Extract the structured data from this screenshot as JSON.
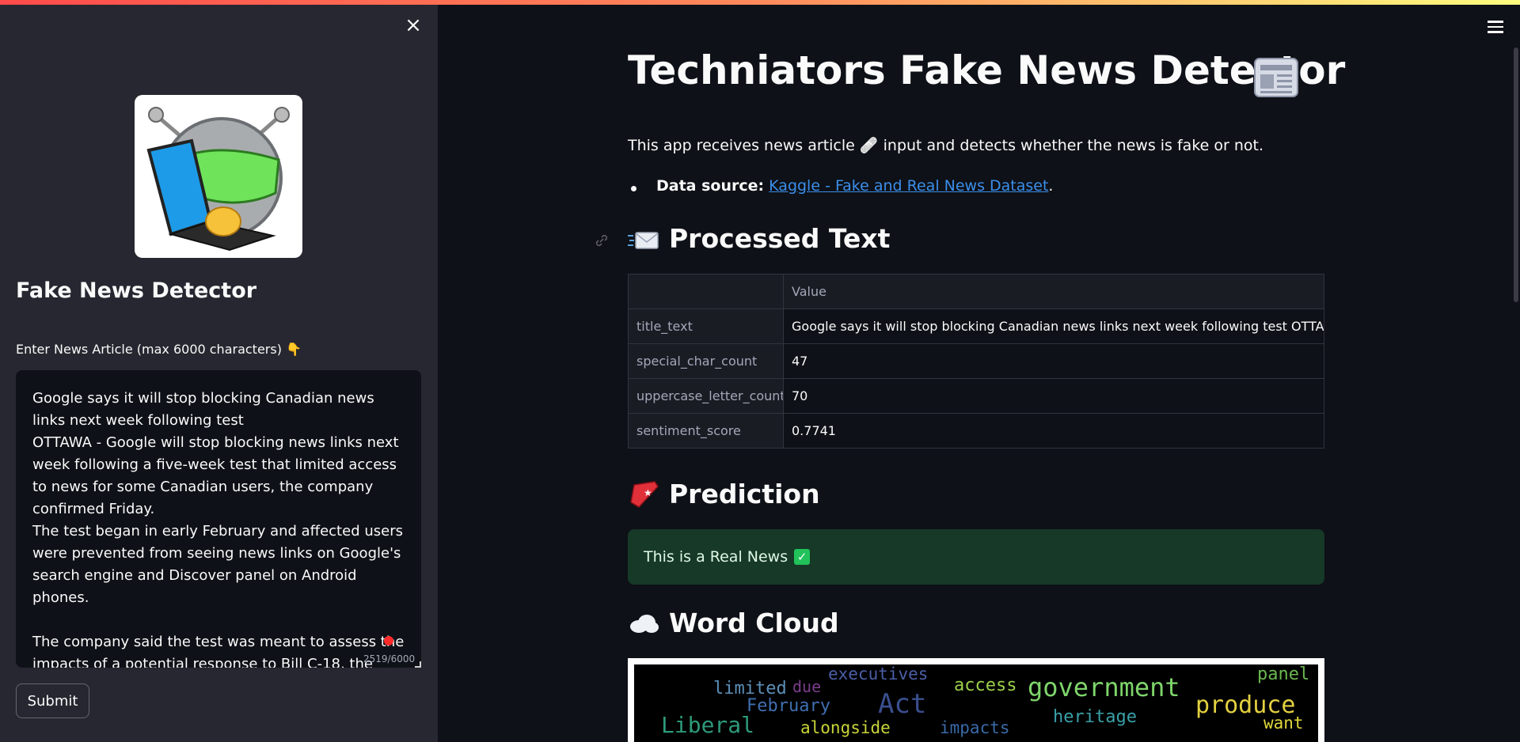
{
  "sidebar": {
    "close_icon": "×",
    "title": "Fake News Detector",
    "input_label": "Enter News Article (max 6000 characters) 👇",
    "article_paragraphs": [
      "Google says it will stop blocking Canadian news links next week following test",
      "OTTAWA - Google will stop blocking news links next week following a five-week test that limited access to news for some Canadian users, the company confirmed Friday.",
      "The test began in early February and affected users were prevented from seeing news links on Google's search engine and Discover panel on Android phones.",
      "",
      "The company said the test was meant to assess the impacts of a potential response to Bill C-18, the Liberal government's controversial Online News Act."
    ],
    "char_count": "2519/6000",
    "submit_label": "Submit"
  },
  "main": {
    "title": "Techniators Fake News Detector",
    "intro_prefix": "This app receives news article",
    "intro_emoji": "🩹",
    "intro_suffix": "input and detects whether the news is fake or not.",
    "data_source_label": "Data source:",
    "data_source_link": "Kaggle - Fake and Real News Dataset",
    "data_source_end": ".",
    "processed_heading": "Processed Text",
    "table": {
      "column_header": "Value",
      "rows": [
        {
          "index": "title_text",
          "value": "Google says it will stop blocking Canadian news links next week following test OTTAWA - Google"
        },
        {
          "index": "special_char_count",
          "value": "47"
        },
        {
          "index": "uppercase_letter_count",
          "value": "70"
        },
        {
          "index": "sentiment_score",
          "value": "0.7741"
        }
      ]
    },
    "prediction_heading": "Prediction",
    "prediction_text": "This is a Real News",
    "prediction_check": "✓",
    "wordcloud_heading": "Word Cloud",
    "wordcloud_words": [
      "limited",
      "due",
      "executives",
      "February",
      "Act",
      "access",
      "government",
      "panel",
      "produce",
      "heritage",
      "Liberal",
      "alongside",
      "impacts",
      "want"
    ]
  },
  "colors": {
    "accent": "#ff4b4b",
    "link": "#3b8eea",
    "success_bg": "#173928",
    "sidebar_bg": "#262730",
    "main_bg": "#0e1117"
  },
  "icons": {
    "close": "close-icon",
    "menu": "hamburger-menu-icon",
    "title_icon": "newspaper-icon",
    "processed_icon": "envelope-icon",
    "prediction_icon": "bookmark-icon",
    "wordcloud_icon": "cloud-icon",
    "success_icon": "check-box-icon"
  }
}
